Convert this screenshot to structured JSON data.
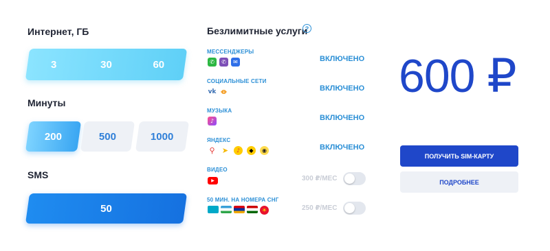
{
  "internet": {
    "heading": "Интернет, ГБ",
    "options": [
      "3",
      "30",
      "60"
    ]
  },
  "minutes": {
    "heading": "Минуты",
    "options": [
      "200",
      "500",
      "1000"
    ],
    "selected": "200"
  },
  "sms": {
    "heading": "SMS",
    "value": "50"
  },
  "unlimited": {
    "heading": "Безлимитные услуги",
    "help_glyph": "?",
    "services": [
      {
        "title": "МЕССЕНДЖЕРЫ",
        "status": "ВКЛЮЧЕНО",
        "icons": [
          "whatsapp-icon",
          "viber-icon",
          "messenger-icon"
        ]
      },
      {
        "title": "СОЦИАЛЬНЫЕ СЕТИ",
        "status": "ВКЛЮЧЕНО",
        "icons": [
          "vk-icon",
          "odnoklassniki-icon"
        ]
      },
      {
        "title": "МУЗЫКА",
        "status": "ВКЛЮЧЕНО",
        "icons": [
          "music-icon"
        ]
      },
      {
        "title": "ЯНДЕКС",
        "status": "ВКЛЮЧЕНО",
        "icons": [
          "yandex-maps-icon",
          "yandex-navigator-icon",
          "yandex-music-icon",
          "yandex-taxi-icon",
          "yandex-eda-icon"
        ]
      },
      {
        "title": "ВИДЕО",
        "price": "300 ₽/МЕС",
        "icons": [
          "youtube-icon"
        ]
      },
      {
        "title": "50 МИН. НА НОМЕРА СНГ",
        "price": "250 ₽/МЕС",
        "icons": [
          "kazakhstan-flag-icon",
          "uzbekistan-flag-icon",
          "armenia-flag-icon",
          "tajikistan-flag-icon",
          "kyrgyzstan-flag-icon"
        ]
      }
    ]
  },
  "summary": {
    "price": "600 ₽",
    "primary_button": "ПОЛУЧИТЬ SIM-КАРТУ",
    "secondary_button": "ПОДРОБНЕЕ"
  },
  "colors": {
    "accent_blue": "#1f47c9",
    "light_blue": "#2b8fd6",
    "internet_gradient": "#5fd0f7",
    "sms_blue": "#1571e0"
  }
}
